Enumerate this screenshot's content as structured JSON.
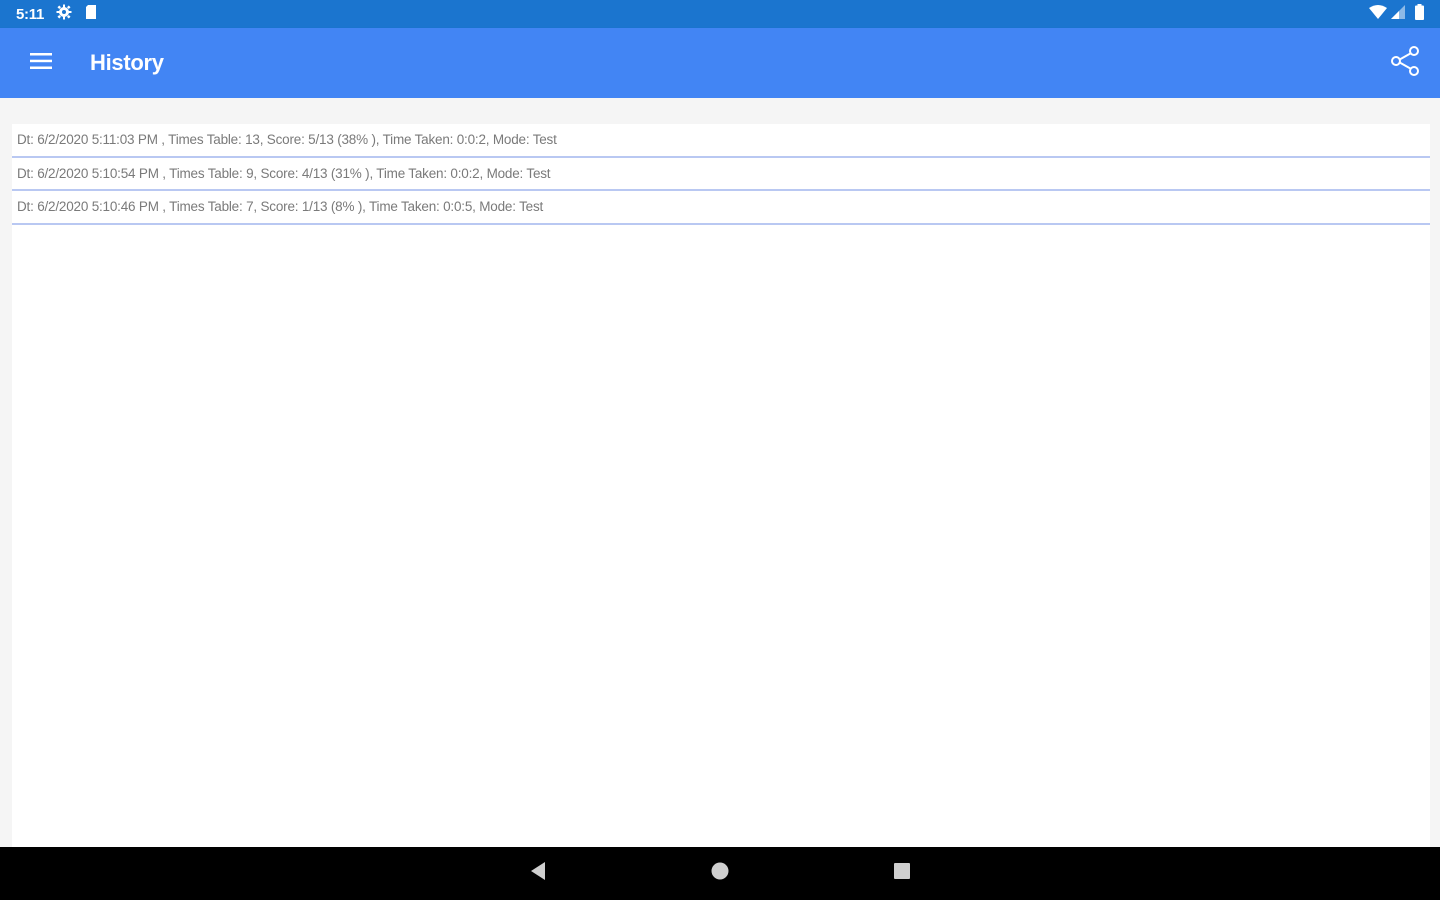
{
  "status_bar": {
    "time": "5:11",
    "icons": [
      "settings-gear-icon",
      "sd-card-icon",
      "wifi-icon",
      "cell-signal-icon",
      "battery-icon"
    ]
  },
  "app_bar": {
    "title": "History",
    "menu_icon": "hamburger-menu-icon",
    "action_icon": "share-icon"
  },
  "history": {
    "items": [
      "Dt: 6/2/2020 5:11:03 PM , Times Table: 13, Score: 5/13 (38% ), Time Taken: 0:0:2, Mode: Test",
      "Dt: 6/2/2020 5:10:54 PM , Times Table: 9, Score: 4/13 (31% ), Time Taken: 0:0:2, Mode: Test",
      "Dt: 6/2/2020 5:10:46 PM , Times Table: 7, Score: 1/13 (8% ), Time Taken: 0:0:5, Mode: Test"
    ]
  },
  "nav_bar": {
    "icons": [
      "back-icon",
      "home-icon",
      "recents-icon"
    ]
  },
  "colors": {
    "status_bar": "#1b75cf",
    "app_bar": "#4285f4",
    "divider": "#b9c8f2",
    "item_text": "#7a7a7a"
  }
}
